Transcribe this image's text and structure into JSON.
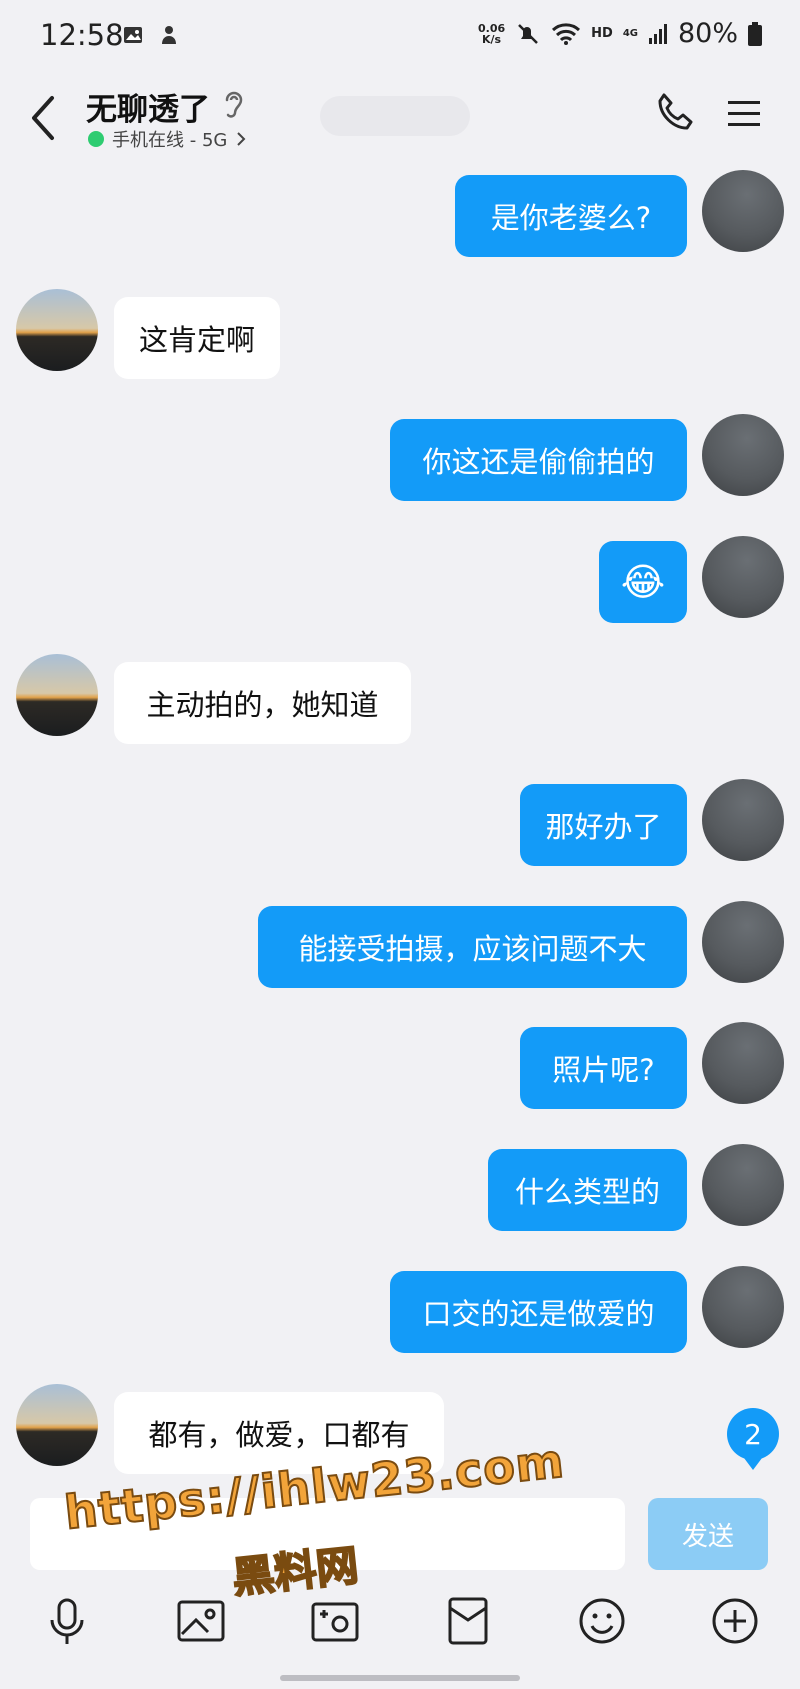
{
  "status_bar": {
    "time": "12:58",
    "net_speed_value": "0.06",
    "net_speed_unit": "K/s",
    "hd": "HD",
    "signal": "4G",
    "battery": "80%"
  },
  "header": {
    "contact_name": "无聊透了",
    "online_status": "手机在线 - 5G"
  },
  "messages": [
    {
      "from": "me",
      "text": "是你老婆么?"
    },
    {
      "from": "other",
      "text": "这肯定啊"
    },
    {
      "from": "me",
      "text": "你这还是偷偷拍的"
    },
    {
      "from": "me",
      "text": "😂"
    },
    {
      "from": "other",
      "text": "主动拍的，她知道"
    },
    {
      "from": "me",
      "text": "那好办了"
    },
    {
      "from": "me",
      "text": "能接受拍摄，应该问题不大"
    },
    {
      "from": "me",
      "text": "照片呢?"
    },
    {
      "from": "me",
      "text": "什么类型的"
    },
    {
      "from": "me",
      "text": "口交的还是做爱的"
    },
    {
      "from": "other",
      "text": "都有，做爱，口都有"
    }
  ],
  "unread_count": "2",
  "input": {
    "value": "",
    "send_label": "发送"
  },
  "watermark": {
    "line1": "https://ihlw23.com",
    "line2": "黑料网"
  },
  "toolbar_icons": [
    "microphone-icon",
    "image-icon",
    "camera-icon",
    "red-packet-icon",
    "emoji-icon",
    "plus-icon"
  ],
  "colors": {
    "my_bubble": "#139bf8",
    "other_bubble": "#ffffff",
    "background": "#f1f1f4",
    "send_button": "#8cccf5",
    "online_dot": "#2ecc71"
  }
}
